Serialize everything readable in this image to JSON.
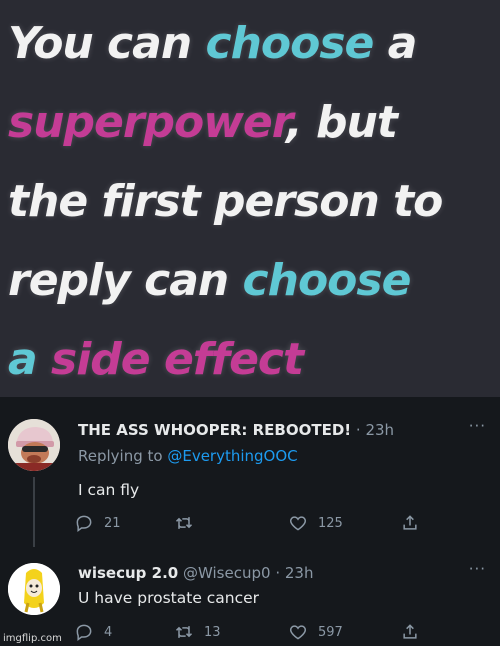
{
  "meme": {
    "lines": [
      [
        {
          "t": "You can ",
          "c": "white"
        },
        {
          "t": "choose",
          "c": "cyan"
        },
        {
          "t": " a",
          "c": "white"
        }
      ],
      [
        {
          "t": "superpower",
          "c": "pink"
        },
        {
          "t": ", but",
          "c": "white"
        }
      ],
      [
        {
          "t": "the first person to",
          "c": "white"
        }
      ],
      [
        {
          "t": "reply can ",
          "c": "white"
        },
        {
          "t": "choose",
          "c": "cyan"
        }
      ],
      [
        {
          "t": "a",
          "c": "cyan"
        },
        {
          "t": " side effect",
          "c": "pink"
        }
      ]
    ],
    "colors": {
      "white": "#f2f2f2",
      "cyan": "#5fc8d4",
      "pink": "#c43c95",
      "background": "#2a2b33"
    }
  },
  "tweets": [
    {
      "name": "THE ASS WHOOPER: REBOOTED!",
      "handle": "",
      "time": "23h",
      "replying_label": "Replying to ",
      "replying_to": "@EverythingOOC",
      "text": "I can fly",
      "replies": "21",
      "retweets": "",
      "likes": "125",
      "avatar_icon": "cartoon-character-avatar"
    },
    {
      "name": "wisecup 2.0",
      "handle": "@Wisecup0",
      "time": "23h",
      "text": "U have prostate cancer",
      "replies": "4",
      "retweets": "13",
      "likes": "597",
      "avatar_icon": "banana-cat-avatar"
    }
  ],
  "more_label": "···",
  "watermark": "imgflip.com",
  "theme": {
    "bg": "#15181c",
    "muted": "#8b98a5",
    "link": "#1d9bf0",
    "text": "#e7e9ea"
  }
}
